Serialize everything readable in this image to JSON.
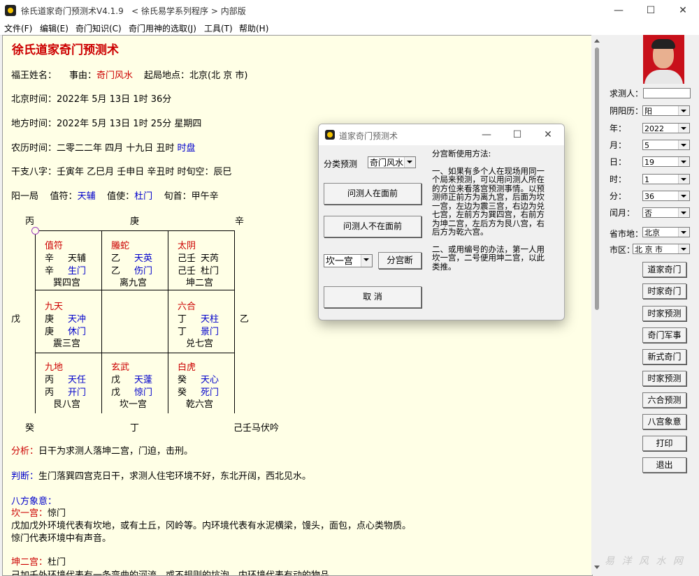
{
  "window": {
    "title": "徐氏道家奇门预测术V4.1.9   < 徐氏易学系列程序 > 内部版",
    "minimize": "—",
    "maximize": "☐",
    "close": "✕"
  },
  "menu": [
    "文件(F)",
    "编辑(E)",
    "奇门知识(C)",
    "奇门用神的选取(J)",
    "工具(T)",
    "帮助(H)"
  ],
  "main": {
    "title": "徐氏道家奇门预测术",
    "info": {
      "fuwang_label": "福王姓名：",
      "shiyou_label": "事由：",
      "shiyou_value": "奇门风水",
      "place_label": "起局地点：",
      "place_value": "北京(北 京 市)",
      "beijing_time": "北京时间：2022年  5月  13日  1时  36分",
      "local_time": "地方时间：2022年  5月  13日  1时  25分  星期四",
      "lunar_prefix": "农历时间：二零二二年  四月  十九日  丑时",
      "lunar_suffix": "时盘",
      "ganzhi": "干支八字：壬寅年  乙巳月  壬申日  辛丑时    时旬空：辰巳",
      "ju": "阳一局",
      "zhifu_label": "值符：",
      "zhifu_value": "天辅",
      "zhishi_label": "值使：",
      "zhishi_value": "杜门",
      "xunshou": "旬首：甲午辛"
    },
    "chart": {
      "outer": {
        "top_left": "丙",
        "top_mid": "庚",
        "top_right": "辛",
        "mid_left": "戊",
        "mid_right": "乙",
        "bottom_left": "癸",
        "bottom_mid": "丁",
        "bottom_right": "己壬马伏吟"
      },
      "palaces": [
        {
          "shen": "值符",
          "r1a": "辛",
          "r1b": "天辅",
          "r2a": "辛",
          "r2b": "生门",
          "name": "巽四宫"
        },
        {
          "shen": "螣蛇",
          "r1a": "乙",
          "r1b": "天英",
          "r2a": "乙",
          "r2b": "伤门",
          "name": "离九宫"
        },
        {
          "shen": "太阴",
          "r1a": "己壬",
          "r1b": "天芮",
          "r2a": "己壬",
          "r2b": "杜门",
          "name": "坤二宫"
        },
        {
          "shen": "九天",
          "r1a": "庚",
          "r1b": "天冲",
          "r2a": "庚",
          "r2b": "休门",
          "name": "震三宫"
        },
        {
          "shen": "",
          "r1a": "",
          "r1b": "",
          "r2a": "",
          "r2b": "",
          "name": ""
        },
        {
          "shen": "六合",
          "r1a": "丁",
          "r1b": "天柱",
          "r2a": "丁",
          "r2b": "景门",
          "name": "兑七宫"
        },
        {
          "shen": "九地",
          "r1a": "丙",
          "r1b": "天任",
          "r2a": "丙",
          "r2b": "开门",
          "name": "艮八宫"
        },
        {
          "shen": "玄武",
          "r1a": "戊",
          "r1b": "天蓬",
          "r2a": "戊",
          "r2b": "惊门",
          "name": "坎一宫"
        },
        {
          "shen": "白虎",
          "r1a": "癸",
          "r1b": "天心",
          "r2a": "癸",
          "r2b": "死门",
          "name": "乾六宫"
        }
      ]
    },
    "analysis": {
      "fenxi_label": "分析：",
      "fenxi_text": "日干为求测人落坤二宫，门迫，击刑。",
      "panduan_label": "判断：",
      "panduan_text": "生门落巽四宫克日干，求测人住宅环境不好，东北开阔，西北见水。",
      "bafang_label": "八方象意：",
      "kan_label": "坎一宫：",
      "kan_door": "惊门",
      "kan_line1": "戊加戊外环境代表有坎地，或有土丘，冈岭等。内环境代表有水泥横梁，馒头，面包，点心类物质。",
      "kan_line2": "惊门代表环境中有声音。",
      "kun_label": "坤二宫：",
      "kun_door": "杜门",
      "kun_line1": "己加壬外环境代表有一条弯曲的河流，或不规则的坑泡，内环境代表有动的物品"
    }
  },
  "side": {
    "qiuceren_label": "求测人：",
    "qiuceren_value": "",
    "yinyangli_label": "阴阳历：",
    "yinyangli_value": "阳",
    "year_label": "年：",
    "year_value": "2022",
    "month_label": "月：",
    "month_value": "5",
    "day_label": "日：",
    "day_value": "19",
    "hour_label": "时：",
    "hour_value": "1",
    "minute_label": "分：",
    "minute_value": "36",
    "runyue_label": "闰月：",
    "runyue_value": "否",
    "province_label": "省市地：",
    "province_value": "北京",
    "district_label": "市区：",
    "district_value": "北 京 市",
    "buttons": [
      "道家奇门",
      "时家奇门",
      "时家预测",
      "奇门军事",
      "新式奇门",
      "时家预测",
      "六合预测",
      "八宫象意",
      "打印",
      "退出"
    ]
  },
  "dialog": {
    "title": "道家奇门预测术",
    "category_label": "分类预测",
    "category_value": "奇门风水",
    "btn_present": "问测人在面前",
    "btn_absent": "问测人不在面前",
    "palace_value": "坎一宫",
    "btn_palace": "分宫断",
    "btn_cancel": "取  消",
    "help_title": "分宫断使用方法:",
    "help_p1": "一、如果有多个人在现场用同一个局来预测，可以用问测人所在的方位来看落宫预测事情。以预测师正前方为离九宫，后面为坎一宫，左边为震三宫，右边为兑七宫，左前方为巽四宫，右前方为坤二宫，左后方为艮八宫，右后方为乾六宫。",
    "help_p2": "二、或用编号的办法，第一人用坎一宫，二号便用坤二宫，以此类推。"
  },
  "watermark": "易 洋 风 水 网"
}
